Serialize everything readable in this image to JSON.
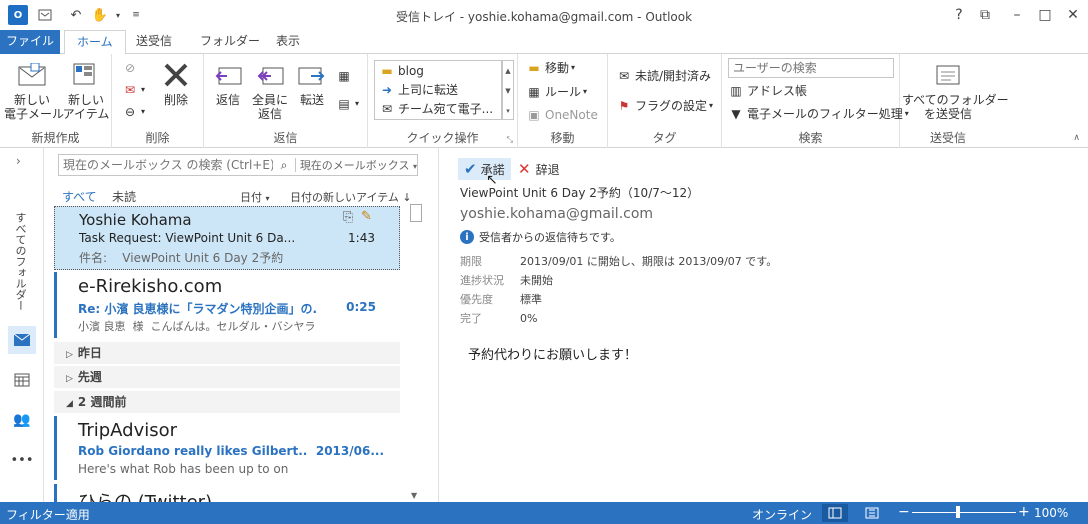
{
  "window": {
    "title": "受信トレイ - yoshie.kohama@gmail.com - Outlook",
    "controls": {
      "help": "?",
      "restore": "⧉",
      "minimize": "–",
      "maximize": "□",
      "close": "✕"
    }
  },
  "tabs": {
    "file": "ファイル",
    "home": "ホーム",
    "send_receive": "送受信",
    "folder": "フォルダー",
    "view": "表示"
  },
  "ribbon": {
    "new": {
      "new_mail": "新しい\n電子メール",
      "new_items": "新しい\nアイテム",
      "group": "新規作成"
    },
    "delete": {
      "delete": "削除",
      "group": "削除"
    },
    "respond": {
      "reply": "返信",
      "reply_all": "全員に\n返信",
      "forward": "転送",
      "group": "返信"
    },
    "quick_steps": {
      "items": [
        "blog",
        "上司に転送",
        "チーム宛て電子..."
      ],
      "group": "クイック操作"
    },
    "move": {
      "move": "移動",
      "rules": "ルール",
      "onenote": "OneNote",
      "group": "移動"
    },
    "tags": {
      "unread_read": "未読/開封済み",
      "follow_up": "フラグの設定",
      "group": "タグ"
    },
    "find": {
      "search_people_placeholder": "ユーザーの検索",
      "address_book": "アドレス帳",
      "filter_email": "電子メールのフィルター処理",
      "group": "検索"
    },
    "send_receive": {
      "send_receive_all": "すべてのフォルダー\nを送受信",
      "group": "送受信"
    }
  },
  "left_rail": {
    "all_folders": "すべてのフォルダー",
    "more": "•••"
  },
  "message_list": {
    "search_placeholder": "現在のメールボックス の検索 (Ctrl+E)",
    "search_scope": "現在のメールボックス",
    "filters": {
      "all": "すべて",
      "unread": "未読",
      "sort_by": "日付",
      "order": "日付の新しいアイテム"
    },
    "messages": [
      {
        "sender": "Yoshie Kohama",
        "subject": "Task Request: ViewPoint Unit 6 Da...",
        "time": "1:43",
        "preview": "件名:    ViewPoint Unit 6 Day 2予約"
      },
      {
        "sender": "e-Rirekisho.com",
        "subject": "Re: 小濱 良恵様に「ラマダン特別企画」の...",
        "time": "0:25",
        "preview": "小濱 良恵  様  こんばんは。セルダル・バシヤラ"
      }
    ],
    "groups": {
      "yesterday": "昨日",
      "last_week": "先週",
      "two_weeks_ago": "2 週間前"
    },
    "messages_older": [
      {
        "sender": "TripAdvisor",
        "subject": "Rob Giordano really likes Gilbert...",
        "time": "2013/06...",
        "preview": "Here's what Rob has been up to on"
      },
      {
        "sender": "ひらの (Twitter)"
      }
    ]
  },
  "reading_pane": {
    "accept": "承諾",
    "decline": "辞退",
    "task_title": "ViewPoint Unit 6 Day 2予約（10/7〜12）",
    "from": "yoshie.kohama@gmail.com",
    "info": "受信者からの返信待ちです。",
    "fields": [
      {
        "label": "期限",
        "value": "2013/09/01 に開始し、期限は 2013/09/07 です。"
      },
      {
        "label": "進捗状況",
        "value": "未開始"
      },
      {
        "label": "優先度",
        "value": "標準"
      },
      {
        "label": "完了",
        "value": "0%"
      }
    ],
    "body": "予約代わりにお願いします！"
  },
  "status_bar": {
    "filter": "フィルター適用",
    "online": "オンライン",
    "zoom": "100%"
  }
}
